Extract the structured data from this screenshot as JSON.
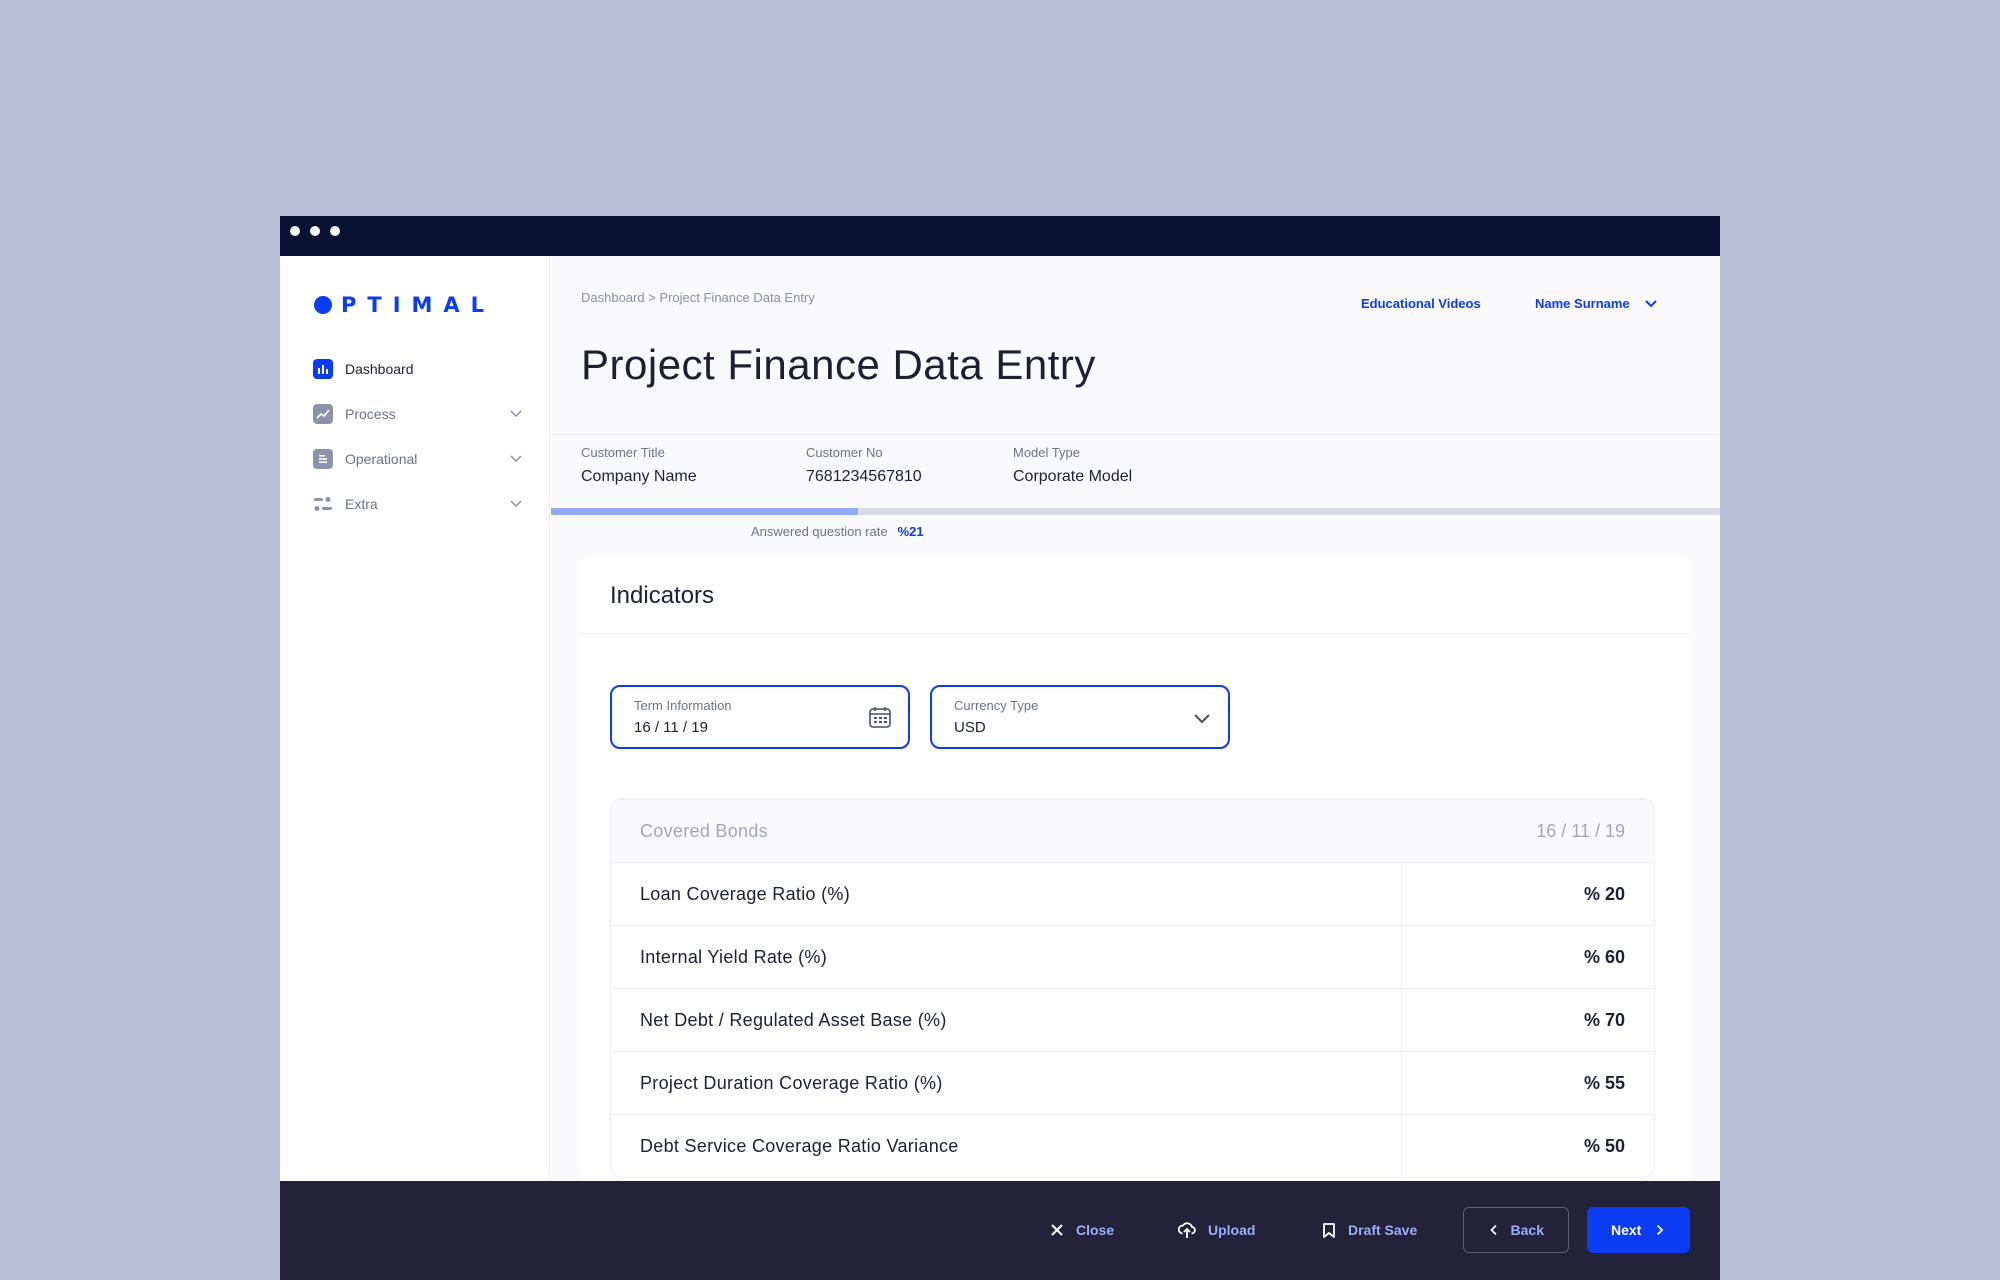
{
  "app": {
    "logo_text": "PTIMAL"
  },
  "sidebar": {
    "items": [
      {
        "label": "Dashboard",
        "icon": "bar-chart-icon",
        "active": true
      },
      {
        "label": "Process",
        "icon": "trend-chart-icon",
        "active": false
      },
      {
        "label": "Operational",
        "icon": "document-icon",
        "active": false
      },
      {
        "label": "Extra",
        "icon": "toggles-icon",
        "active": false
      }
    ]
  },
  "header": {
    "breadcrumb": "Dashboard > Project Finance Data Entry",
    "educational_videos": "Educational Videos",
    "user_name": "Name Surname",
    "title": "Project Finance Data Entry"
  },
  "info": {
    "customer_title_label": "Customer Title",
    "customer_title_value": "Company Name",
    "customer_no_label": "Customer No",
    "customer_no_value": "7681234567810",
    "model_type_label": "Model Type",
    "model_type_value": "Corporate Model"
  },
  "progress": {
    "label": "Answered question rate",
    "value_text": "%21",
    "fraction": 0.21
  },
  "indicators": {
    "title": "Indicators",
    "term_label": "Term Information",
    "term_value": "16 / 11 / 19",
    "currency_label": "Currency Type",
    "currency_value": "USD",
    "table_header": {
      "name": "Covered Bonds",
      "date": "16 / 11 / 19"
    },
    "rows": [
      {
        "name": "Loan Coverage Ratio (%)",
        "value": "% 20"
      },
      {
        "name": "Internal Yield Rate (%)",
        "value": "% 60"
      },
      {
        "name": "Net Debt / Regulated Asset Base (%)",
        "value": "% 70"
      },
      {
        "name": "Project Duration Coverage Ratio (%)",
        "value": "% 55"
      },
      {
        "name": "Debt Service Coverage Ratio Variance",
        "value": "% 50"
      }
    ]
  },
  "footer": {
    "close": "Close",
    "upload": "Upload",
    "draft_save": "Draft Save",
    "back": "Back",
    "next": "Next"
  },
  "colors": {
    "accent": "#0c3cf2",
    "titlebar": "#081233",
    "footer": "#23223a",
    "background": "#b7c0d6"
  }
}
